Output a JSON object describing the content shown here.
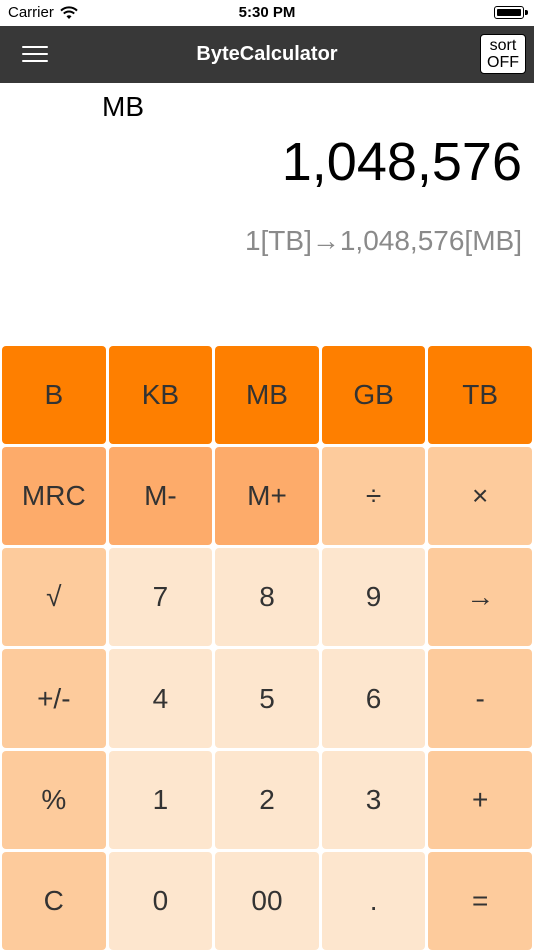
{
  "status": {
    "carrier": "Carrier",
    "time": "5:30 PM"
  },
  "navbar": {
    "title": "ByteCalculator",
    "sort_line1": "sort",
    "sort_line2": "OFF"
  },
  "display": {
    "unit": "MB",
    "value": "1,048,576",
    "history": "1[TB]→1,048,576[MB]"
  },
  "keys": [
    [
      "B",
      "KB",
      "MB",
      "GB",
      "TB"
    ],
    [
      "MRC",
      "M-",
      "M+",
      "÷",
      "×"
    ],
    [
      "√",
      "7",
      "8",
      "9",
      "→"
    ],
    [
      "+/-",
      "4",
      "5",
      "6",
      "-"
    ],
    [
      "%",
      "1",
      "2",
      "3",
      "+"
    ],
    [
      "C",
      "0",
      "00",
      ".",
      "="
    ]
  ],
  "colors": {
    "unit_keys": "#fe7f00",
    "memory_keys": "#fdab6a",
    "operator_keys": "#fdcb9c",
    "digit_keys": "#fde6ce",
    "navbar": "#383838"
  }
}
